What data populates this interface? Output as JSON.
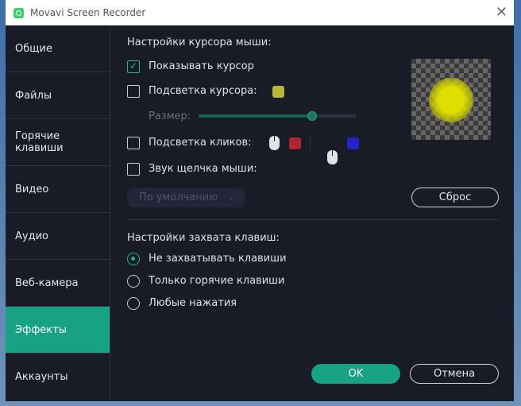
{
  "window": {
    "title": "Movavi Screen Recorder"
  },
  "sidebar": {
    "items": [
      {
        "label": "Общие"
      },
      {
        "label": "Файлы"
      },
      {
        "label": "Горячие клавиши"
      },
      {
        "label": "Видео"
      },
      {
        "label": "Аудио"
      },
      {
        "label": "Веб-камера"
      },
      {
        "label": "Эффекты",
        "active": true
      },
      {
        "label": "Аккаунты"
      }
    ]
  },
  "cursor": {
    "heading": "Настройки курсора мыши:",
    "show_cursor": "Показывать курсор",
    "show_cursor_checked": true,
    "highlight": "Подсветка курсора:",
    "highlight_color": "#b8b832",
    "size_label": "Размер:",
    "size_value": 0.72,
    "clicks": "Подсветка кликов:",
    "left_click_color": "#b0262c",
    "right_click_color": "#2424c8",
    "sound": "Звук щелчка мыши:",
    "sound_select": "По умолчанию",
    "reset": "Сброс"
  },
  "keys": {
    "heading": "Настройки захвата клавиш:",
    "options": [
      "Не захватывать клавиши",
      "Только горячие клавиши",
      "Любые нажатия"
    ],
    "selected": 0
  },
  "footer": {
    "ok": "OK",
    "cancel": "Отмена"
  }
}
